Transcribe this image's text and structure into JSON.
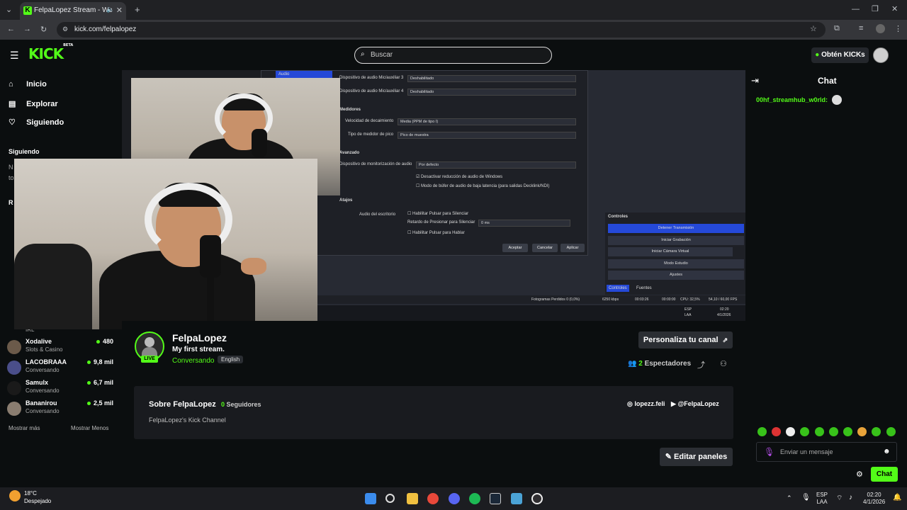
{
  "browser": {
    "tab_title": "FelpaLopez Stream - Watch",
    "tab_logo": "K",
    "url": "kick.com/felpalopez",
    "icons": [
      "chevron-down-icon",
      "back-icon",
      "forward-icon",
      "reload-icon",
      "star-icon",
      "extensions-icon",
      "menu-icon"
    ]
  },
  "header": {
    "logo": "KICK",
    "logo_badge": "BETA",
    "search_placeholder": "Buscar",
    "kicks_button": "Obtén KICKs"
  },
  "sidebar": {
    "nav": [
      {
        "label": "Inicio",
        "icon": "home-icon"
      },
      {
        "label": "Explorar",
        "icon": "browse-icon"
      },
      {
        "label": "Siguiendo",
        "icon": "heart-icon"
      }
    ],
    "following_heading": "Siguiendo",
    "partial_text_1": "N",
    "partial_text_2": "to",
    "partial_heading": "R",
    "channels": [
      {
        "name": "Xodalive",
        "category": "Slots & Casino",
        "viewers": "480"
      },
      {
        "name": "LACOBRAAA",
        "category": "Conversando",
        "viewers": "9,8 mil"
      },
      {
        "name": "Samulx",
        "category": "Conversando",
        "viewers": "6,7 mil"
      },
      {
        "name": "Bananirou",
        "category": "Conversando",
        "viewers": "2,5 mil"
      }
    ],
    "partial_category": "IRL",
    "show_more": "Mostrar más",
    "show_less": "Mostrar Menos"
  },
  "obs": {
    "audio_tab": "Audio",
    "rows": [
      {
        "label": "Dispositivo de audio Mic/auxiliar 3",
        "value": "Deshabilitado"
      },
      {
        "label": "Dispositivo de audio Mic/auxiliar 4",
        "value": "Deshabilitado"
      }
    ],
    "medidores_heading": "Medidores",
    "decay_label": "Velocidad de decaimiento",
    "decay_value": "Media (PPM de tipo I)",
    "peak_label": "Tipo de medidor de pico",
    "peak_value": "Pico de muestra",
    "avanzado_heading": "Avanzado",
    "monitor_label": "Dispositivo de monitorización de audio",
    "monitor_value": "Por defecto",
    "check1": "Desactivar reducción de audio de Windows",
    "check2": "Modo de búfer de audio de baja latencia (para salidas Decklink/NDI)",
    "atajos_heading": "Atajos",
    "desk_label": "Audio del escritorio",
    "ptm_enable": "Habilitar Pulsar para Silenciar",
    "ptm_delay": "Retardo de Presionar para Silenciar",
    "ptm_delay_value": "0 ms",
    "ptt_enable": "Habilitar Pulsar para Hablar",
    "btn_ok": "Aceptar",
    "btn_cancel": "Cancelar",
    "btn_apply": "Aplicar",
    "controls_title": "Controles",
    "controls": [
      "Detener Transmisión",
      "Iniciar Grabación",
      "Iniciar Cámara Virtual",
      "Modo Estudio",
      "Ajustes"
    ],
    "tab_controls": "Controles",
    "tab_sources": "Fuentes",
    "status": "Fotogramas Perdidos 0 (0,0%)",
    "kbps": "6250 kbps",
    "time1": "00:03:26",
    "time2": "00:00:00",
    "cpu": "CPU: 32,5%",
    "fps": "54,10 / 60,00 FPS",
    "inner_lang": "ESP",
    "inner_layout": "LAA",
    "inner_time": "02:20",
    "inner_date": "4/1/2026"
  },
  "channel": {
    "name": "FelpaLopez",
    "live_label": "LIVE",
    "stream_title": "My first stream.",
    "category": "Conversando",
    "language": "English",
    "customize_button": "Personaliza tu canal",
    "viewers_count": "2",
    "viewers_label": "Espectadores"
  },
  "about": {
    "heading": "Sobre FelpaLopez",
    "followers_count": "0",
    "followers_label": "Seguidores",
    "description": "FelpaLopez's Kick Channel",
    "instagram": "lopezz.feli",
    "youtube": "@FelpaLopez"
  },
  "edit_panels_button": "Editar paneles",
  "chat": {
    "title": "Chat",
    "message_user": "00hf_streamhub_w0rld:",
    "input_placeholder": "Enviar un mensaje",
    "send_button": "Chat"
  },
  "windows": {
    "temp": "18°C",
    "weather": "Despejado",
    "lang": "ESP",
    "layout": "LAA",
    "time": "02:20",
    "date": "4/1/2026"
  },
  "colors": {
    "brand": "#53fc18",
    "background": "#0b0e0f",
    "obs_highlight": "#2549d8"
  }
}
